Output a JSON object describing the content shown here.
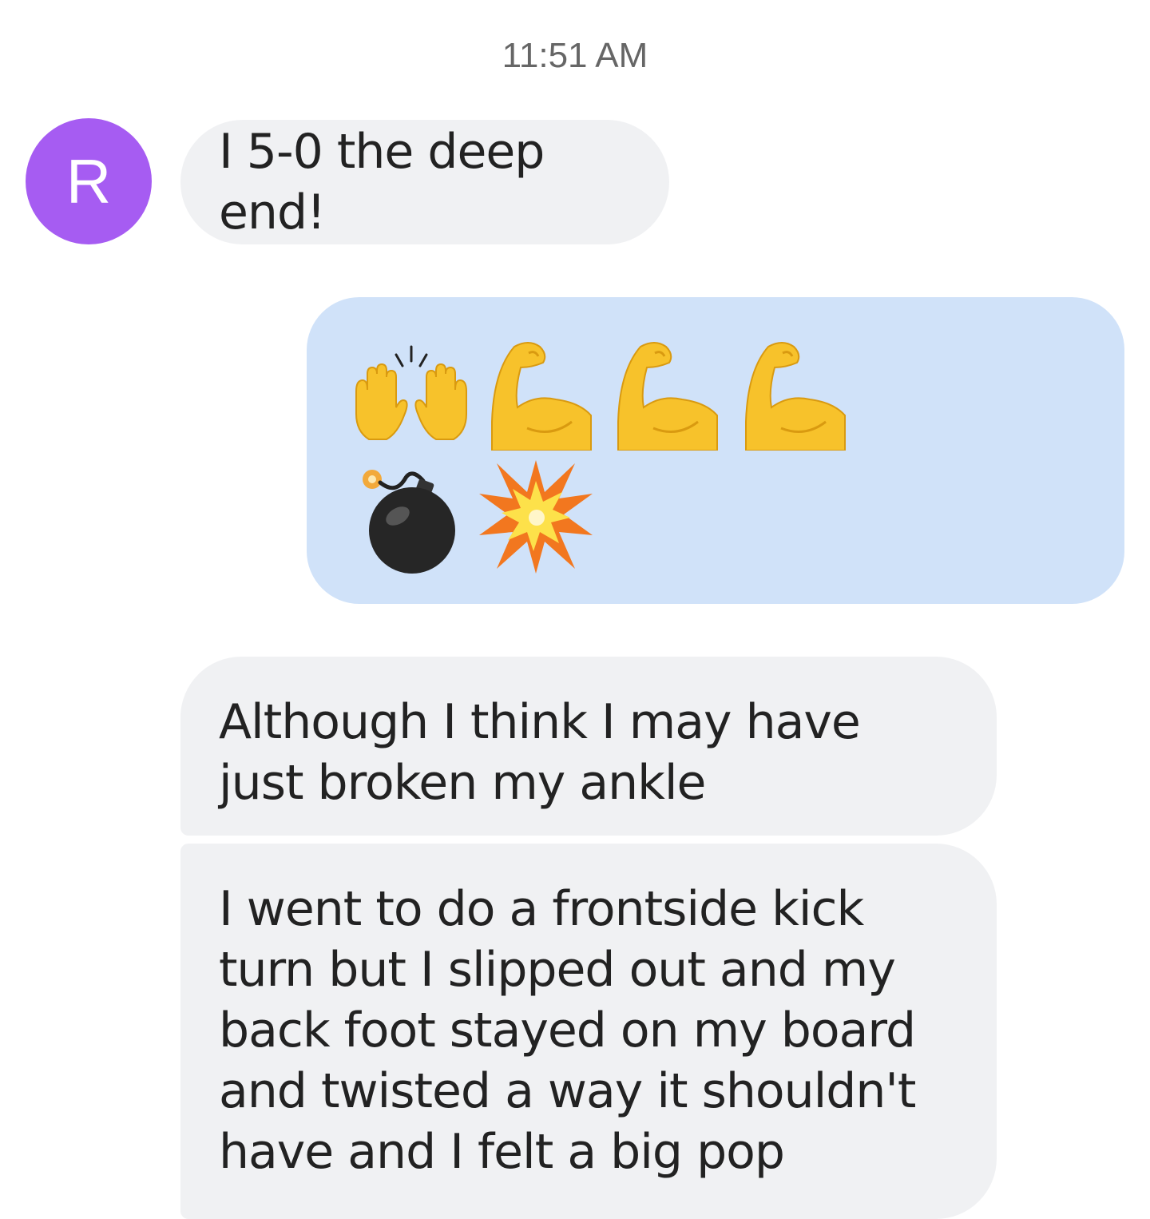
{
  "conversation": {
    "timestamp": "11:51 AM",
    "contact": {
      "avatar_initial": "R",
      "avatar_color": "#a65cf2"
    },
    "messages": [
      {
        "direction": "incoming",
        "text": "I 5-0 the deep end!"
      },
      {
        "direction": "outgoing",
        "emojis": [
          "raising-hands",
          "flexed-biceps",
          "flexed-biceps",
          "flexed-biceps",
          "bomb",
          "collision"
        ]
      },
      {
        "direction": "incoming",
        "text": "Although I think I may have just broken my ankle"
      },
      {
        "direction": "incoming",
        "text": "I went to do a frontside kick turn but I slipped out and my back foot stayed on my board and twisted a way it shouldn't have and I felt a big pop"
      }
    ]
  },
  "colors": {
    "incoming_bubble": "#f0f1f3",
    "outgoing_bubble": "#d0e2f9",
    "emoji_yellow": "#f7c22b",
    "bomb_black": "#222222",
    "explosion_orange": "#f2771f"
  }
}
